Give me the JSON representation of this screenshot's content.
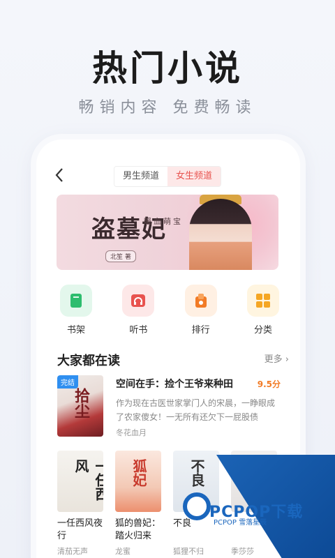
{
  "hero": {
    "title": "热门小说",
    "subtitle": "畅销内容 免费畅读"
  },
  "header": {
    "back_icon": "chevron-left-icon",
    "tabs": [
      {
        "label": "男生频道",
        "active": false
      },
      {
        "label": "女生频道",
        "active": true
      }
    ]
  },
  "banner": {
    "book_title": "盗墓妃",
    "tagline": "暖血萌宝",
    "author": "北笙 著"
  },
  "quick_nav": [
    {
      "label": "书架",
      "icon": "bookshelf-icon",
      "color": "#2dbd6e"
    },
    {
      "label": "听书",
      "icon": "headphones-icon",
      "color": "#e8534f"
    },
    {
      "label": "排行",
      "icon": "ranking-icon",
      "color": "#f27b26"
    },
    {
      "label": "分类",
      "icon": "category-grid-icon",
      "color": "#f5a623"
    }
  ],
  "section": {
    "title": "大家都在读",
    "more": "更多 ›"
  },
  "featured": {
    "badge": "完结",
    "cover_text": "拾尘",
    "title": "空间在手：捡个王爷来种田",
    "score": "9.5分",
    "description": "作为现在古医世家掌门人的宋晨，一睁眼成了农家傻女！一无所有还欠下一屁股债",
    "author": "冬花血月"
  },
  "grid_books": [
    {
      "cover_text": "一任西风",
      "title": "一任西风夜行",
      "author": "清茄无声"
    },
    {
      "cover_text": "狐妃",
      "title": "狐的兽妃：踏火归来",
      "author": "龙蜜"
    },
    {
      "cover_text": "不良",
      "title": "不良",
      "author": "狐狸不归"
    },
    {
      "cover_text": "",
      "title": "",
      "author": "季莎莎"
    }
  ],
  "watermark": {
    "brand": "PCPOP下载",
    "sub": "PCPOP 雪落星辰"
  }
}
